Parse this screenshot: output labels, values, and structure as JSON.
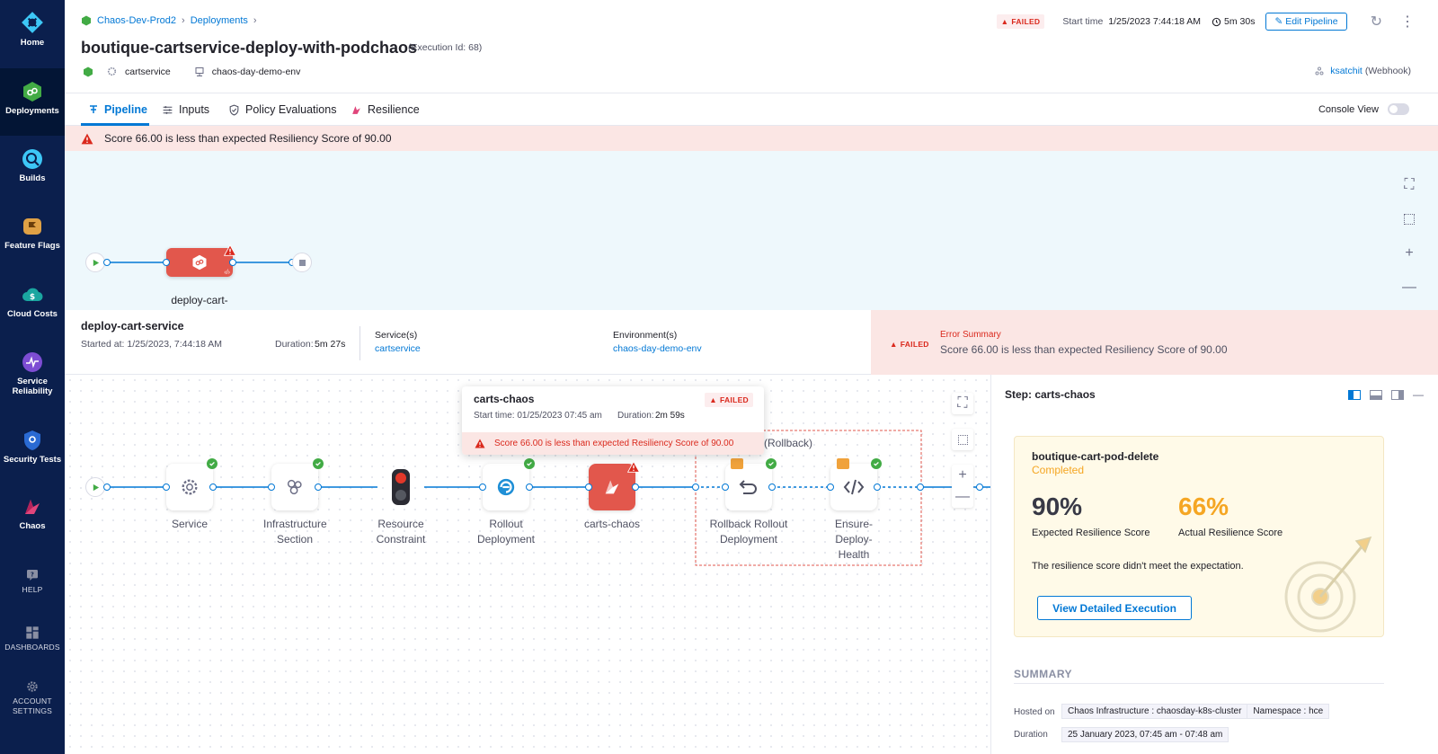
{
  "sidebar": {
    "items": [
      {
        "label": "Home"
      },
      {
        "label": "Deployments"
      },
      {
        "label": "Builds"
      },
      {
        "label": "Feature Flags"
      },
      {
        "label": "Cloud Costs"
      },
      {
        "label": "Service Reliability"
      },
      {
        "label": "Security Tests"
      },
      {
        "label": "Chaos"
      }
    ],
    "help": "HELP",
    "dashboards": "DASHBOARDS",
    "account_settings": "ACCOUNT SETTINGS"
  },
  "header": {
    "breadcrumb": [
      "Chaos-Dev-Prod2",
      "Deployments"
    ],
    "title": "boutique-cartservice-deploy-with-podchaos",
    "execution_id": "(Execution Id: 68)",
    "service": "cartservice",
    "environment": "chaos-day-demo-env",
    "status": "FAILED",
    "start_time_label": "Start time",
    "start_time": "1/25/2023 7:44:18 AM",
    "duration": "5m 30s",
    "edit_button": "Edit Pipeline",
    "trigger_user": "ksatchit",
    "trigger_type": "(Webhook)"
  },
  "tabs": [
    {
      "label": "Pipeline"
    },
    {
      "label": "Inputs"
    },
    {
      "label": "Policy Evaluations"
    },
    {
      "label": "Resilience"
    }
  ],
  "console_view_label": "Console View",
  "error_banner": "Score 66.00 is less than expected Resiliency Score of 90.00",
  "top_canvas": {
    "stage_label": "deploy-cart-"
  },
  "stage": {
    "name": "deploy-cart-service",
    "started_at": "Started at: 1/25/2023, 7:44:18 AM",
    "duration_label": "Duration:",
    "duration": "5m 27s",
    "services_label": "Service(s)",
    "services": "cartservice",
    "env_label": "Environment(s)",
    "env": "chaos-day-demo-env",
    "status": "FAILED",
    "error_summary_label": "Error Summary",
    "error_summary": "Score 66.00 is less than expected Resiliency Score of 90.00"
  },
  "steps": [
    {
      "label": "Service"
    },
    {
      "label": "Infrastructure Section"
    },
    {
      "label": "Resource Constraint"
    },
    {
      "label": "Rollout Deployment"
    },
    {
      "label": "carts-chaos"
    },
    {
      "label": "Rollback Rollout Deployment"
    },
    {
      "label": "Ensure-Deploy-Health"
    }
  ],
  "rollback_label": "(Rollback)",
  "tooltip": {
    "title": "carts-chaos",
    "status": "FAILED",
    "start_time": "Start time: 01/25/2023 07:45 am",
    "duration_label": "Duration:",
    "duration": "2m 59s",
    "error": "Score 66.00 is less than expected Resiliency Score of 90.00"
  },
  "step_panel": {
    "title": "Step: carts-chaos",
    "experiment": "boutique-cart-pod-delete",
    "experiment_status": "Completed",
    "expected_score": "90%",
    "expected_label": "Expected Resilience Score",
    "actual_score": "66%",
    "actual_label": "Actual Resilience Score",
    "message": "The resilience score didn't meet the expectation.",
    "view_button": "View Detailed Execution",
    "summary_heading": "SUMMARY",
    "hosted_on_label": "Hosted on",
    "infrastructure": "Chaos Infrastructure : chaosday-k8s-cluster",
    "namespace": "Namespace : hce",
    "duration_label": "Duration",
    "duration_value": "25 January 2023, 07:45 am - 07:48 am"
  },
  "colors": {
    "sidebar_bg": "#0b1f4d",
    "accent": "#0278d5",
    "failed": "#da291d",
    "success": "#42ab45",
    "chaos_node": "#e2574c",
    "actual_score": "#f5a623"
  }
}
